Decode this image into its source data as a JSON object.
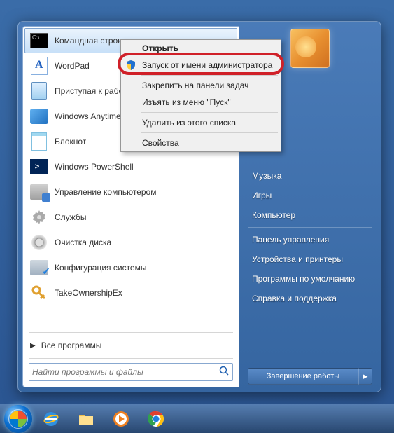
{
  "programs": [
    {
      "label": "Командная строка",
      "icon": "cmd"
    },
    {
      "label": "WordPad",
      "icon": "wordpad"
    },
    {
      "label": "Приступая к работе",
      "icon": "doc"
    },
    {
      "label": "Windows Anytime Upgrade",
      "icon": "anytime"
    },
    {
      "label": "Блокнот",
      "icon": "notepad"
    },
    {
      "label": "Windows PowerShell",
      "icon": "ps"
    },
    {
      "label": "Управление компьютером",
      "icon": "mgmt"
    },
    {
      "label": "Службы",
      "icon": "gear"
    },
    {
      "label": "Очистка диска",
      "icon": "disk"
    },
    {
      "label": "Конфигурация системы",
      "icon": "msconfig"
    },
    {
      "label": "TakeOwnershipEx",
      "icon": "key"
    }
  ],
  "all_programs_label": "Все программы",
  "search": {
    "placeholder": "Найти программы и файлы"
  },
  "right_items_top": [
    "Музыка",
    "Игры",
    "Компьютер"
  ],
  "right_items_bottom": [
    "Панель управления",
    "Устройства и принтеры",
    "Программы по умолчанию",
    "Справка и поддержка"
  ],
  "shutdown_label": "Завершение работы",
  "context_menu": {
    "open": "Открыть",
    "run_as_admin": "Запуск от имени администратора",
    "pin_taskbar": "Закрепить на панели задач",
    "remove_start": "Изъять из меню \"Пуск\"",
    "remove_list": "Удалить из этого списка",
    "properties": "Свойства"
  }
}
